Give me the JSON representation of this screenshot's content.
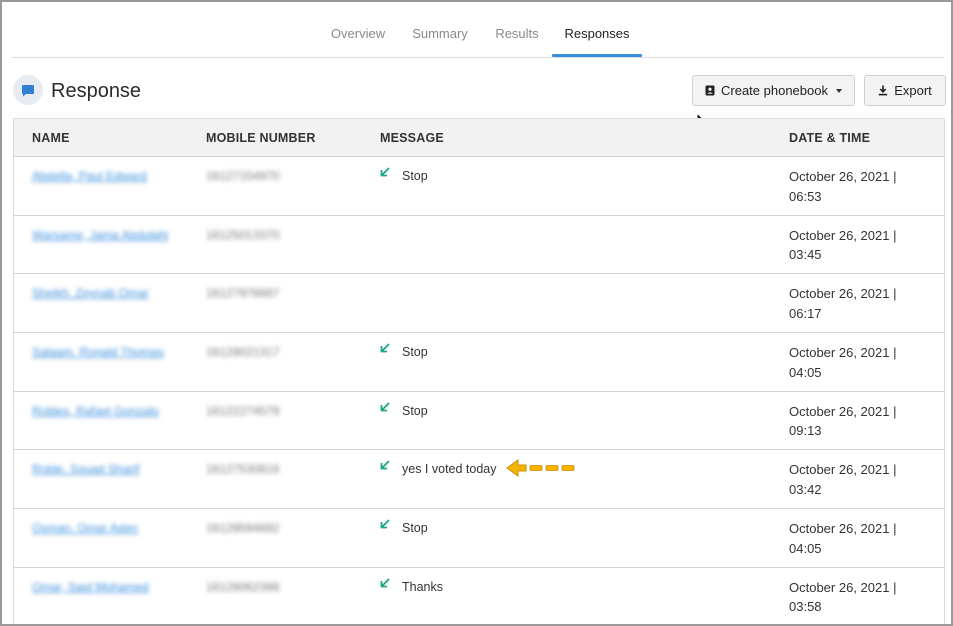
{
  "tabs": [
    {
      "label": "Overview",
      "active": false
    },
    {
      "label": "Summary",
      "active": false
    },
    {
      "label": "Results",
      "active": false
    },
    {
      "label": "Responses",
      "active": true
    }
  ],
  "header": {
    "title": "Response",
    "create_label": "Create phonebook",
    "export_label": "Export"
  },
  "table": {
    "columns": [
      "NAME",
      "MOBILE NUMBER",
      "MESSAGE",
      "DATE & TIME"
    ],
    "rows": [
      {
        "name": "Abdella, Paul Edward",
        "mobile": "16127154970",
        "message": "Stop",
        "date": "October 26, 2021 |",
        "time": "06:53"
      },
      {
        "name": "Warsame, Jama Abdulahi",
        "mobile": "16125013370",
        "message": "",
        "date": "October 26, 2021 |",
        "time": "03:45"
      },
      {
        "name": "Sheikh, Zeynab Omar",
        "mobile": "16127976667",
        "message": "",
        "date": "October 26, 2021 |",
        "time": "06:17"
      },
      {
        "name": "Salaam, Ronald Thomas",
        "mobile": "16128021317",
        "message": "Stop",
        "date": "October 26, 2021 |",
        "time": "04:05"
      },
      {
        "name": "Robles, Rafael Gonzalo",
        "mobile": "16122274579",
        "message": "Stop",
        "date": "October 26, 2021 |",
        "time": "09:13"
      },
      {
        "name": "Roble, Souad Sharif",
        "mobile": "16127530816",
        "message": "yes I voted today",
        "date": "October 26, 2021 |",
        "time": "03:42"
      },
      {
        "name": "Osman, Omar Aden",
        "mobile": "16128594682",
        "message": "Stop",
        "date": "October 26, 2021 |",
        "time": "04:05"
      },
      {
        "name": "Omar, Said Mohamed",
        "mobile": "16128062388",
        "message": "Thanks",
        "date": "October 26, 2021 |",
        "time": "03:58"
      }
    ]
  },
  "colors": {
    "accent": "#3a8fdc",
    "incoming_icon": "#1aa587",
    "annotation_arrow": "#f5b400"
  },
  "icons": {
    "response": "chat-bubble-icon",
    "create": "phonebook-icon",
    "export": "download-icon",
    "message": "incoming-arrow-icon"
  }
}
